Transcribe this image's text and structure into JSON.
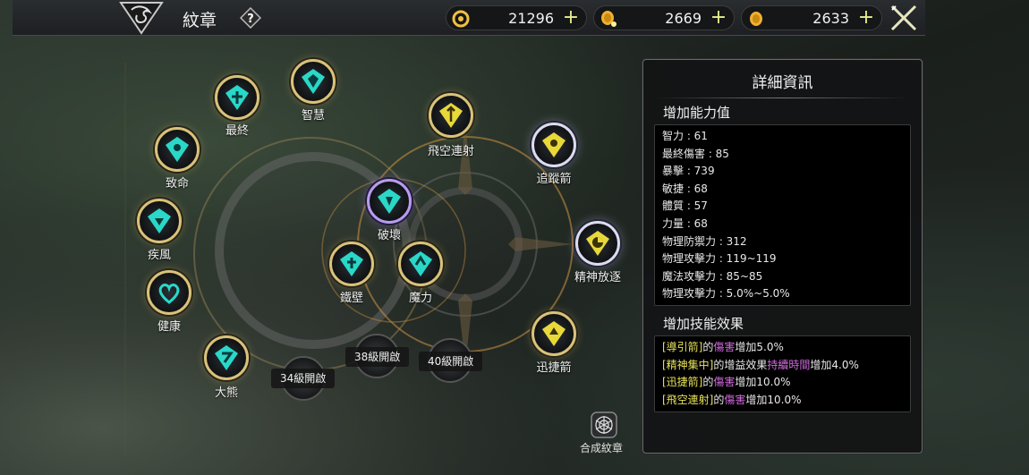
{
  "header": {
    "title": "紋章",
    "help_icon": "help-icon",
    "currencies": [
      {
        "icon": "swirl-coin-icon",
        "color": "#f0c040",
        "value": "21296"
      },
      {
        "icon": "gold-coin-stack-icon",
        "color": "#f0b030",
        "value": "2669"
      },
      {
        "icon": "gold-coin-icon",
        "color": "#f0b030",
        "value": "2633"
      }
    ],
    "add_symbol": "+",
    "close_icon": "close-crossed-swords-icon"
  },
  "emblems": [
    {
      "name": "智慧",
      "color": "#2ad8c8"
    },
    {
      "name": "最終",
      "color": "#2ad8c8"
    },
    {
      "name": "致命",
      "color": "#2ad8c8"
    },
    {
      "name": "疾風",
      "color": "#2ad8c8"
    },
    {
      "name": "健康",
      "color": "#2ad8c8"
    },
    {
      "name": "大熊",
      "color": "#2ad8c8"
    },
    {
      "name": "飛空連射",
      "color": "#e8d83a"
    },
    {
      "name": "追蹤箭",
      "color": "#e8d83a"
    },
    {
      "name": "精神放逐",
      "color": "#e8d83a"
    },
    {
      "name": "迅捷箭",
      "color": "#e8d83a"
    },
    {
      "name": "破壞",
      "color": "#2ad8c8"
    },
    {
      "name": "鐵壁",
      "color": "#2ad8c8"
    },
    {
      "name": "魔力",
      "color": "#2ad8c8"
    }
  ],
  "locked_slots": [
    "34級開啟",
    "38級開啟",
    "40級開啟"
  ],
  "combine": {
    "label": "合成紋章",
    "icon": "combine-web-icon"
  },
  "details": {
    "title": "詳細資訊",
    "stats_title": "增加能力值",
    "stats": [
      "智力 : 61",
      "最終傷害 : 85",
      "暴擊 : 739",
      "敏捷 : 68",
      "體質 : 57",
      "力量 : 68",
      "物理防禦力 : 312",
      "物理攻擊力 : 119~119",
      "魔法攻擊力 : 85~85",
      "物理攻擊力 : 5.0%~5.0%"
    ],
    "effects_title": "增加技能效果",
    "effects": [
      [
        {
          "t": "[導引箭]",
          "c": "y"
        },
        {
          "t": "的",
          "c": ""
        },
        {
          "t": "傷害",
          "c": "p"
        },
        {
          "t": "增加5.0%",
          "c": ""
        }
      ],
      [
        {
          "t": "[精神集中]",
          "c": "y"
        },
        {
          "t": "的增益效果",
          "c": ""
        },
        {
          "t": "持續時間",
          "c": "p"
        },
        {
          "t": "增加4.0%",
          "c": ""
        }
      ],
      [
        {
          "t": "[迅捷箭]",
          "c": "y"
        },
        {
          "t": "的",
          "c": ""
        },
        {
          "t": "傷害",
          "c": "p"
        },
        {
          "t": "增加10.0%",
          "c": ""
        }
      ],
      [
        {
          "t": "[飛空連射]",
          "c": "y"
        },
        {
          "t": "的",
          "c": ""
        },
        {
          "t": "傷害",
          "c": "p"
        },
        {
          "t": "增加10.0%",
          "c": ""
        }
      ]
    ]
  }
}
